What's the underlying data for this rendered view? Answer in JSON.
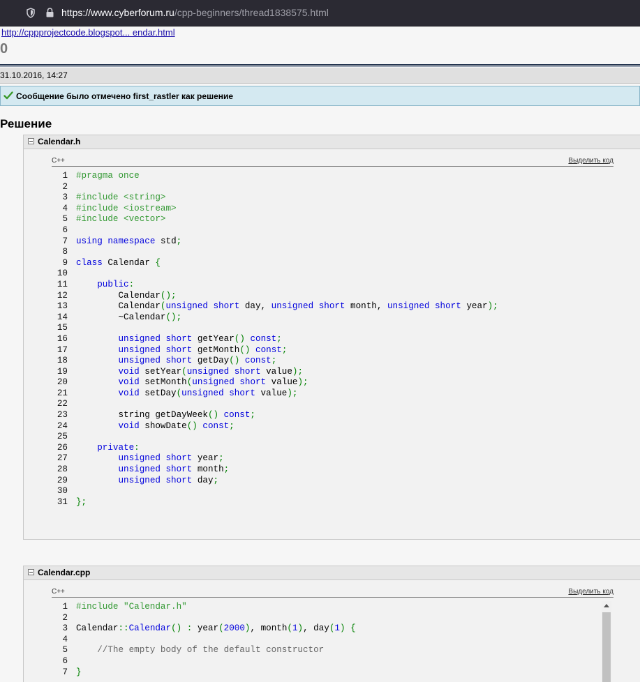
{
  "browser": {
    "url_host": "https://www.cyberforum.ru",
    "url_path": "/cpp-beginners/thread1838575.html"
  },
  "post": {
    "link": "http://cppprojectcode.blogspot... endar.html",
    "number": "0",
    "date": "31.10.2016, 14:27",
    "solved_text": "Сообщение было отмечено first_rastler как решение",
    "heading": "Решение"
  },
  "code_blocks": [
    {
      "title": "Calendar.h",
      "lang": "C++",
      "select_label": "Выделить код",
      "lines": [
        [
          [
            "pp",
            "#pragma once"
          ]
        ],
        [],
        [
          [
            "pp",
            "#include <string>"
          ]
        ],
        [
          [
            "pp",
            "#include <iostream>"
          ]
        ],
        [
          [
            "pp",
            "#include <vector>"
          ]
        ],
        [],
        [
          [
            "kw",
            "using"
          ],
          [
            "nm",
            " "
          ],
          [
            "kw",
            "namespace"
          ],
          [
            "nm",
            " std"
          ],
          [
            "op",
            ";"
          ]
        ],
        [],
        [
          [
            "kw",
            "class"
          ],
          [
            "nm",
            " Calendar "
          ],
          [
            "op",
            "{"
          ]
        ],
        [],
        [
          [
            "nm",
            "    "
          ],
          [
            "kw",
            "public"
          ],
          [
            "op",
            ":"
          ]
        ],
        [
          [
            "nm",
            "        Calendar"
          ],
          [
            "op",
            "();"
          ]
        ],
        [
          [
            "nm",
            "        Calendar"
          ],
          [
            "op",
            "("
          ],
          [
            "kw",
            "unsigned"
          ],
          [
            "nm",
            " "
          ],
          [
            "kw",
            "short"
          ],
          [
            "nm",
            " day, "
          ],
          [
            "kw",
            "unsigned"
          ],
          [
            "nm",
            " "
          ],
          [
            "kw",
            "short"
          ],
          [
            "nm",
            " month, "
          ],
          [
            "kw",
            "unsigned"
          ],
          [
            "nm",
            " "
          ],
          [
            "kw",
            "short"
          ],
          [
            "nm",
            " year"
          ],
          [
            "op",
            ");"
          ]
        ],
        [
          [
            "nm",
            "        ~Calendar"
          ],
          [
            "op",
            "();"
          ]
        ],
        [],
        [
          [
            "nm",
            "        "
          ],
          [
            "kw",
            "unsigned"
          ],
          [
            "nm",
            " "
          ],
          [
            "kw",
            "short"
          ],
          [
            "nm",
            " getYear"
          ],
          [
            "op",
            "()"
          ],
          [
            "nm",
            " "
          ],
          [
            "kw",
            "const"
          ],
          [
            "op",
            ";"
          ]
        ],
        [
          [
            "nm",
            "        "
          ],
          [
            "kw",
            "unsigned"
          ],
          [
            "nm",
            " "
          ],
          [
            "kw",
            "short"
          ],
          [
            "nm",
            " getMonth"
          ],
          [
            "op",
            "()"
          ],
          [
            "nm",
            " "
          ],
          [
            "kw",
            "const"
          ],
          [
            "op",
            ";"
          ]
        ],
        [
          [
            "nm",
            "        "
          ],
          [
            "kw",
            "unsigned"
          ],
          [
            "nm",
            " "
          ],
          [
            "kw",
            "short"
          ],
          [
            "nm",
            " getDay"
          ],
          [
            "op",
            "()"
          ],
          [
            "nm",
            " "
          ],
          [
            "kw",
            "const"
          ],
          [
            "op",
            ";"
          ]
        ],
        [
          [
            "nm",
            "        "
          ],
          [
            "kw",
            "void"
          ],
          [
            "nm",
            " setYear"
          ],
          [
            "op",
            "("
          ],
          [
            "kw",
            "unsigned"
          ],
          [
            "nm",
            " "
          ],
          [
            "kw",
            "short"
          ],
          [
            "nm",
            " value"
          ],
          [
            "op",
            ");"
          ]
        ],
        [
          [
            "nm",
            "        "
          ],
          [
            "kw",
            "void"
          ],
          [
            "nm",
            " setMonth"
          ],
          [
            "op",
            "("
          ],
          [
            "kw",
            "unsigned"
          ],
          [
            "nm",
            " "
          ],
          [
            "kw",
            "short"
          ],
          [
            "nm",
            " value"
          ],
          [
            "op",
            ");"
          ]
        ],
        [
          [
            "nm",
            "        "
          ],
          [
            "kw",
            "void"
          ],
          [
            "nm",
            " setDay"
          ],
          [
            "op",
            "("
          ],
          [
            "kw",
            "unsigned"
          ],
          [
            "nm",
            " "
          ],
          [
            "kw",
            "short"
          ],
          [
            "nm",
            " value"
          ],
          [
            "op",
            ");"
          ]
        ],
        [],
        [
          [
            "nm",
            "        string getDayWeek"
          ],
          [
            "op",
            "()"
          ],
          [
            "nm",
            " "
          ],
          [
            "kw",
            "const"
          ],
          [
            "op",
            ";"
          ]
        ],
        [
          [
            "nm",
            "        "
          ],
          [
            "kw",
            "void"
          ],
          [
            "nm",
            " showDate"
          ],
          [
            "op",
            "()"
          ],
          [
            "nm",
            " "
          ],
          [
            "kw",
            "const"
          ],
          [
            "op",
            ";"
          ]
        ],
        [],
        [
          [
            "nm",
            "    "
          ],
          [
            "kw",
            "private"
          ],
          [
            "op",
            ":"
          ]
        ],
        [
          [
            "nm",
            "        "
          ],
          [
            "kw",
            "unsigned"
          ],
          [
            "nm",
            " "
          ],
          [
            "kw",
            "short"
          ],
          [
            "nm",
            " year"
          ],
          [
            "op",
            ";"
          ]
        ],
        [
          [
            "nm",
            "        "
          ],
          [
            "kw",
            "unsigned"
          ],
          [
            "nm",
            " "
          ],
          [
            "kw",
            "short"
          ],
          [
            "nm",
            " month"
          ],
          [
            "op",
            ";"
          ]
        ],
        [
          [
            "nm",
            "        "
          ],
          [
            "kw",
            "unsigned"
          ],
          [
            "nm",
            " "
          ],
          [
            "kw",
            "short"
          ],
          [
            "nm",
            " day"
          ],
          [
            "op",
            ";"
          ]
        ],
        [],
        [
          [
            "op",
            "};"
          ]
        ]
      ]
    },
    {
      "title": "Calendar.cpp",
      "lang": "C++",
      "select_label": "Выделить код",
      "lines": [
        [
          [
            "pp",
            "#include \"Calendar.h\""
          ]
        ],
        [],
        [
          [
            "nm",
            "Calendar"
          ],
          [
            "op",
            "::"
          ],
          [
            "kw",
            "Calendar"
          ],
          [
            "op",
            "()"
          ],
          [
            "nm",
            " "
          ],
          [
            "op",
            ":"
          ],
          [
            "nm",
            " year"
          ],
          [
            "op",
            "("
          ],
          [
            "num",
            "2000"
          ],
          [
            "op",
            ")"
          ],
          [
            "nm",
            ", month"
          ],
          [
            "op",
            "("
          ],
          [
            "num",
            "1"
          ],
          [
            "op",
            ")"
          ],
          [
            "nm",
            ", day"
          ],
          [
            "op",
            "("
          ],
          [
            "num",
            "1"
          ],
          [
            "op",
            ")"
          ],
          [
            "nm",
            " "
          ],
          [
            "op",
            "{"
          ]
        ],
        [],
        [
          [
            "nm",
            "    "
          ],
          [
            "cm",
            "//The empty body of the default constructor"
          ]
        ],
        [],
        [
          [
            "op",
            "}"
          ]
        ]
      ]
    }
  ]
}
